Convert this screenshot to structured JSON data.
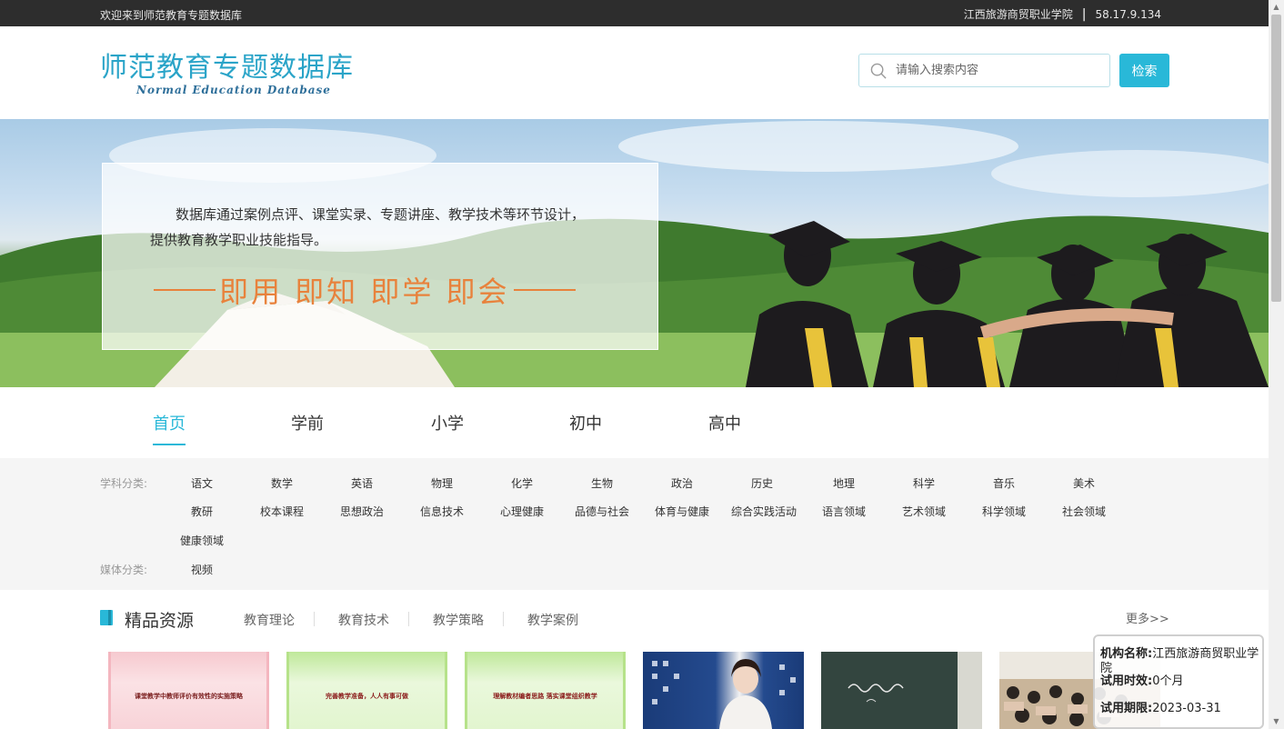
{
  "topbar": {
    "welcome": "欢迎来到师范教育专题数据库",
    "institution": "江西旅游商贸职业学院",
    "separator": "|",
    "ip": "58.17.9.134"
  },
  "header": {
    "logo_title": "师范教育专题数据库",
    "logo_subtitle": "Normal Education Database",
    "search_placeholder": "请输入搜索内容",
    "search_button": "检索"
  },
  "banner": {
    "line1": "数据库通过案例点评、课堂实录、专题讲座、教学技术等环节设计，",
    "line2": "提供教育教学职业技能指导。",
    "slogan": "即用 即知 即学 即会"
  },
  "nav": {
    "items": [
      "首页",
      "学前",
      "小学",
      "初中",
      "高中"
    ]
  },
  "categories": {
    "subject_label": "学科分类:",
    "subjects": [
      "语文",
      "数学",
      "英语",
      "物理",
      "化学",
      "生物",
      "政治",
      "历史",
      "地理",
      "科学",
      "音乐",
      "美术",
      "教研",
      "校本课程",
      "思想政治",
      "信息技术",
      "心理健康",
      "品德与社会",
      "体育与健康",
      "综合实践活动",
      "语言领域",
      "艺术领域",
      "科学领域",
      "社会领域",
      "健康领域"
    ],
    "media_label": "媒体分类:",
    "media": [
      "视频"
    ]
  },
  "section": {
    "title": "精品资源",
    "tabs": [
      "教育理论",
      "教育技术",
      "教学策略",
      "教学案例"
    ],
    "more": "更多>>"
  },
  "thumbnails": [
    {
      "caption": "课堂教学中教师评价有效性的实施策略"
    },
    {
      "caption": "完善教学准备，人人有事可做"
    },
    {
      "caption": "理解教材编者思路 落实课堂组织教学"
    },
    {
      "caption": ""
    },
    {
      "caption": ""
    },
    {
      "caption": ""
    }
  ],
  "popup": {
    "org_label": "机构名称:",
    "org_value": "江西旅游商贸职业学院",
    "duration_label": "试用时效:",
    "duration_value": "0个月",
    "deadline_label": "试用期限:",
    "deadline_value": "2023-03-31"
  },
  "colors": {
    "accent": "#29b8d8",
    "slogan": "#e8823c",
    "topbar": "#2d2d2d"
  }
}
